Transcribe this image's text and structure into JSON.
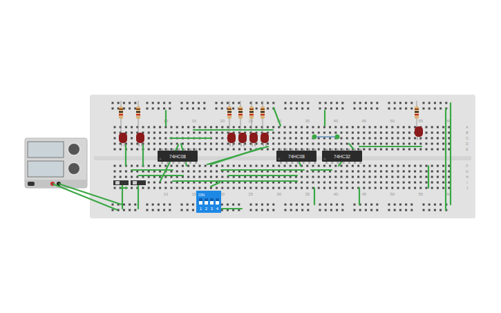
{
  "canvas": {
    "kind": "breadboard-circuit"
  },
  "breadboard": {
    "column_numbers_top": [
      "10",
      "15",
      "20",
      "25",
      "30",
      "35",
      "40",
      "45",
      "50",
      "55",
      "60"
    ],
    "column_numbers_bottom": [
      "10",
      "15",
      "20",
      "25",
      "30",
      "35",
      "40",
      "45",
      "50",
      "55",
      "60"
    ],
    "row_letters_top": [
      "A",
      "B",
      "C",
      "D",
      "E"
    ],
    "row_letters_bottom": [
      "F",
      "G",
      "H",
      "I",
      "J"
    ]
  },
  "chips": [
    {
      "label": "74HC08"
    },
    {
      "label": "74HC08"
    },
    {
      "label": "74HC32"
    }
  ],
  "leds": [
    {
      "lit": false,
      "color": "#8b1a1a"
    },
    {
      "lit": false,
      "color": "#8b1a1a"
    },
    {
      "lit": false,
      "color": "#8b1a1a"
    },
    {
      "lit": false,
      "color": "#8b1a1a"
    },
    {
      "lit": false,
      "color": "#8b1a1a"
    },
    {
      "lit": false,
      "color": "#8b1a1a"
    },
    {
      "lit": false,
      "color": "#8b1a1a"
    }
  ],
  "dip_switch": {
    "label": "ON",
    "switches": [
      {
        "label": "1",
        "on": false
      },
      {
        "label": "2",
        "on": false
      },
      {
        "label": "3",
        "on": false
      },
      {
        "label": "4",
        "on": false
      }
    ]
  },
  "power_supply": {
    "on": false
  }
}
